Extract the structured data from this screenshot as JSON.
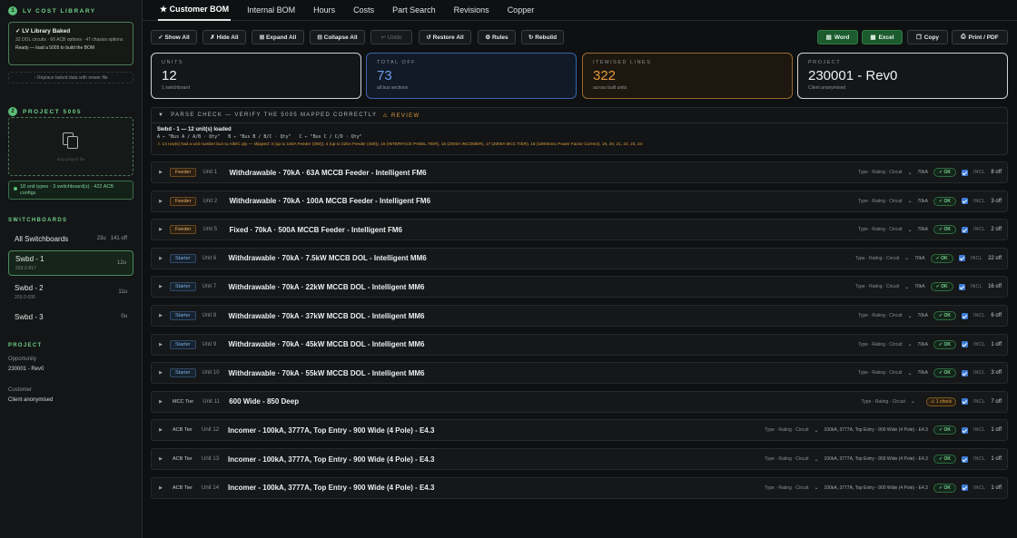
{
  "sidebar": {
    "step1": {
      "num": "1",
      "title": "LV COST LIBRARY"
    },
    "baked": {
      "title": "✓ LV Library Baked",
      "stats": "32 DOL circuits · 66 ACB options · 47 chassis options",
      "ready": "Ready — load a 5005 to build the BOM"
    },
    "replace": "↑ Replace baked data with newer file",
    "step2": {
      "num": "2",
      "title": "PROJECT 5005"
    },
    "drop_label": "drop project file",
    "unit_info": "18 unit types · 3 switchboard(s) · 422 ACB configs",
    "switchboards_heading": "SWITCHBOARDS",
    "all": {
      "label": "All Switchboards",
      "units": "23u",
      "off": "141 off"
    },
    "boards": [
      {
        "name": "Swbd - 1",
        "code": "203-2-817",
        "units": "12u"
      },
      {
        "name": "Swbd - 2",
        "code": "203-2-030",
        "units": "11u"
      },
      {
        "name": "Swbd - 3",
        "code": "",
        "units": "0u"
      }
    ],
    "project_heading": "PROJECT",
    "opportunity_label": "Opportunity",
    "opportunity_value": "230001 - Rev0",
    "customer_label": "Customer",
    "customer_value": "Client anonymised"
  },
  "tabs": [
    "★ Customer BOM",
    "Internal BOM",
    "Hours",
    "Costs",
    "Part Search",
    "Revisions",
    "Copper"
  ],
  "toolbar": {
    "show_all": "✓ Show All",
    "hide_all": "✗ Hide All",
    "expand_all": "⊞ Expand All",
    "collapse_all": "⊟ Collapse All",
    "undo": "↩ Undo",
    "restore_all": "↺ Restore All",
    "rules": "⚙ Rules",
    "rebuild": "↻ Rebuild",
    "word": "Word",
    "excel": "Excel",
    "copy": "Copy",
    "print": "Print / PDF"
  },
  "cards": {
    "units": {
      "label": "UNITS",
      "value": "12",
      "sub": "1 switchboard"
    },
    "total_off": {
      "label": "TOTAL OFF",
      "value": "73",
      "sub": "all bus sections"
    },
    "itemised": {
      "label": "ITEMISED LINES",
      "value": "322",
      "sub": "across built units"
    },
    "project": {
      "label": "PROJECT",
      "value": "230001 - Rev0",
      "sub": "Client anonymised"
    }
  },
  "parse": {
    "heading": "PARSE CHECK — VERIFY THE 5005 MAPPED CORRECTLY",
    "review": "⚠ REVIEW",
    "line1": "Swbd - 1 — 12 unit(s) loaded",
    "line2": "A ← \"Bus A / A/B · Qty\"   B ← \"Bus B / B/C · Qty\"   C ← \"Bus C / C/D · Qty\"",
    "line3": "⚠ 13 row(s) had a unit number but no A/B/C qty — skipped: 3 (up to 160A Feeder (300)), 4 (up to 225A Feeder (450)), 15 (INTERFACE PANEL TIER), 16 (2000A INCOMER), 17 (2000A MCC TIER), 18 (1800mmx Power Factor Correct), 19, 20, 21, 22, 23, 24"
  },
  "rows": [
    {
      "badge": "Feeder",
      "unit": "Unit 1",
      "name": "Withdrawable · 70kA · 63A MCCB Feeder - Intelligent FM6",
      "trc": "Type · Rating · Circuit",
      "rating": "70kA",
      "status": "✓ OK",
      "incl": "INCL",
      "off": "8 off"
    },
    {
      "badge": "Feeder",
      "unit": "Unit 2",
      "name": "Withdrawable · 70kA · 100A MCCB Feeder - Intelligent FM6",
      "trc": "Type · Rating · Circuit",
      "rating": "70kA",
      "status": "✓ OK",
      "incl": "INCL",
      "off": "3 off"
    },
    {
      "badge": "Feeder",
      "unit": "Unit 5",
      "name": "Fixed · 70kA · 500A MCCB Feeder - Intelligent FM6",
      "trc": "Type · Rating · Circuit",
      "rating": "70kA",
      "status": "✓ OK",
      "incl": "INCL",
      "off": "2 off"
    },
    {
      "badge": "Starter",
      "unit": "Unit 6",
      "name": "Withdrawable · 70kA · 7.5kW MCCB DOL - Intelligent MM6",
      "trc": "Type · Rating · Circuit",
      "rating": "70kA",
      "status": "✓ OK",
      "incl": "INCL",
      "off": "22 off"
    },
    {
      "badge": "Starter",
      "unit": "Unit 7",
      "name": "Withdrawable · 70kA · 22kW MCCB DOL - Intelligent MM6",
      "trc": "Type · Rating · Circuit",
      "rating": "70kA",
      "status": "✓ OK",
      "incl": "INCL",
      "off": "16 off"
    },
    {
      "badge": "Starter",
      "unit": "Unit 8",
      "name": "Withdrawable · 70kA · 37kW MCCB DOL - Intelligent MM6",
      "trc": "Type · Rating · Circuit",
      "rating": "70kA",
      "status": "✓ OK",
      "incl": "INCL",
      "off": "6 off"
    },
    {
      "badge": "Starter",
      "unit": "Unit 9",
      "name": "Withdrawable · 70kA · 45kW MCCB DOL - Intelligent MM6",
      "trc": "Type · Rating · Circuit",
      "rating": "70kA",
      "status": "✓ OK",
      "incl": "INCL",
      "off": "1 off"
    },
    {
      "badge": "Starter",
      "unit": "Unit 10",
      "name": "Withdrawable · 70kA · 55kW MCCB DOL - Intelligent MM6",
      "trc": "Type · Rating · Circuit",
      "rating": "70kA",
      "status": "✓ OK",
      "incl": "INCL",
      "off": "3 off"
    },
    {
      "badge": "MCC Tier",
      "unit": "Unit 11",
      "name": "600 Wide - 850 Deep",
      "trc": "Type · Rating · Circuit",
      "rating": "",
      "status": "⚠ 1 check",
      "incl": "INCL",
      "off": "7 off"
    },
    {
      "badge": "ACB Tier",
      "unit": "Unit 12",
      "name": "Incomer - 100kA, 3777A, Top Entry - 900 Wide (4 Pole) - E4.3",
      "trc": "Type · Rating · Circuit",
      "rating": "100kA, 3777A, Top Entry - 900 Wide (4 Pole) - E4.3",
      "status": "✓ OK",
      "incl": "INCL",
      "off": "1 off"
    },
    {
      "badge": "ACB Tier",
      "unit": "Unit 13",
      "name": "Incomer - 100kA, 3777A, Top Entry - 900 Wide (4 Pole) - E4.3",
      "trc": "Type · Rating · Circuit",
      "rating": "100kA, 3777A, Top Entry - 900 Wide (4 Pole) - E4.3",
      "status": "✓ OK",
      "incl": "INCL",
      "off": "1 off"
    },
    {
      "badge": "ACB Tier",
      "unit": "Unit 14",
      "name": "Incomer - 100kA, 3777A, Top Entry - 900 Wide (4 Pole) - E4.3",
      "trc": "Type · Rating · Circuit",
      "rating": "100kA, 3777A, Top Entry - 900 Wide (4 Pole) - E4.3",
      "status": "✓ OK",
      "incl": "INCL",
      "off": "1 off"
    }
  ],
  "colors": {
    "accent_green": "#5bbf78",
    "units_card": "#e4e6e6",
    "total_off_card": "#5b8fe0",
    "itemised_card": "#e69a3c",
    "ok": "#78d28f",
    "warn": "#e3a446"
  }
}
